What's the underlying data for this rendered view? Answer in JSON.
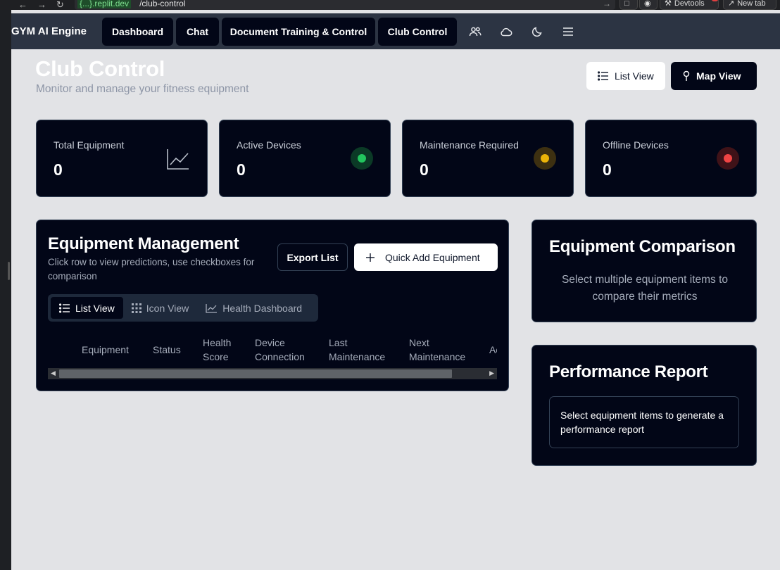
{
  "browser": {
    "host_prefix": "{...}",
    "host_suffix": ".replit.dev",
    "path": "/club-control",
    "devtools_label": "Devtools",
    "newtab_label": "New tab"
  },
  "nav": {
    "brand": "GYM AI Engine",
    "items": [
      "Dashboard",
      "Chat",
      "Document Training & Control",
      "Club Control"
    ],
    "icons": [
      "users-icon",
      "cloud-icon",
      "moon-icon",
      "menu-icon"
    ]
  },
  "header": {
    "title": "Club Control",
    "subtitle": "Monitor and manage your fitness equipment",
    "list_view": "List View",
    "map_view": "Map View"
  },
  "stats": [
    {
      "label": "Total Equipment",
      "value": "0",
      "icon": "chart-line-icon"
    },
    {
      "label": "Active Devices",
      "value": "0",
      "color": "#22c55e"
    },
    {
      "label": "Maintenance Required",
      "value": "0",
      "color": "#eab308"
    },
    {
      "label": "Offline Devices",
      "value": "0",
      "color": "#ef4444"
    }
  ],
  "equipment": {
    "title": "Equipment Management",
    "description": "Click row to view predictions, use checkboxes for comparison",
    "export": "Export List",
    "quick_add": "Quick Add Equipment",
    "tabs": [
      "List View",
      "Icon View",
      "Health Dashboard"
    ],
    "columns": [
      [
        "Equipment",
        ""
      ],
      [
        "Status",
        ""
      ],
      [
        "Health",
        "Score"
      ],
      [
        "Device",
        "Connection"
      ],
      [
        "Last",
        "Maintenance"
      ],
      [
        "Next",
        "Maintenance"
      ],
      [
        "Ac",
        ""
      ]
    ]
  },
  "comparison": {
    "title": "Equipment Comparison",
    "message": "Select multiple equipment items to compare their metrics"
  },
  "performance": {
    "title": "Performance Report",
    "message": "Select equipment items to generate a performance report"
  }
}
